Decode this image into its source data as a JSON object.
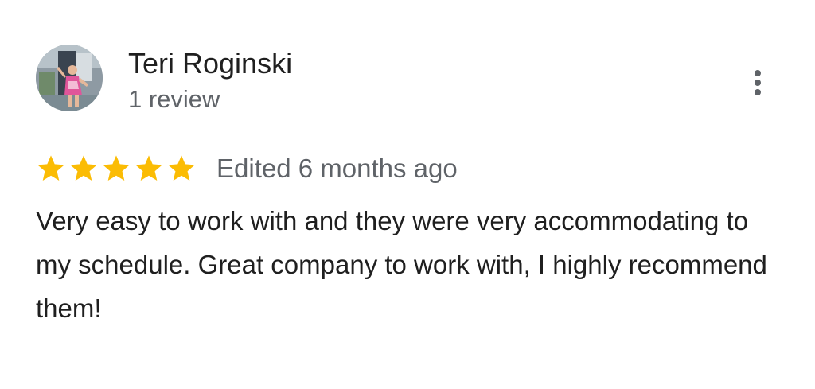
{
  "review": {
    "author_name": "Teri Roginski",
    "review_count": "1 review",
    "rating": 5,
    "rating_max": 5,
    "edited_label": "Edited 6 months ago",
    "text": "Very easy to work with and they were very accommodating to my schedule. Great company to work with, I highly recommend them!"
  },
  "icons": {
    "star": "star-icon",
    "more": "more-vert-icon"
  },
  "colors": {
    "star": "#fbbc04",
    "primary_text": "#1f1f1f",
    "secondary_text": "#5f6368"
  }
}
